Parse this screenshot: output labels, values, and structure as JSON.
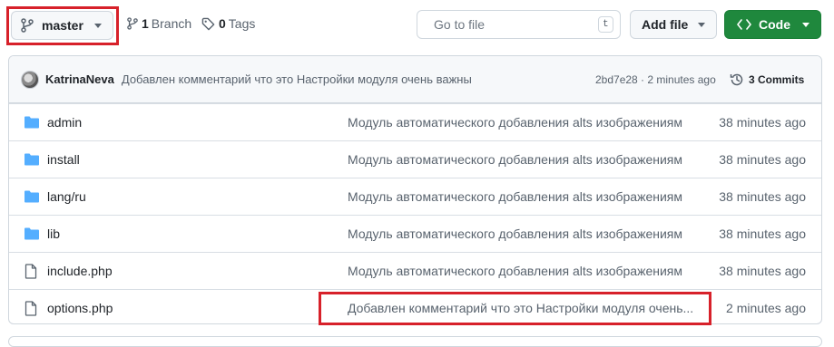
{
  "toolbar": {
    "branch_label": "master",
    "branches_count": "1",
    "branches_label": "Branch",
    "tags_count": "0",
    "tags_label": "Tags",
    "search_placeholder": "Go to file",
    "search_shortcut": "t",
    "add_file_label": "Add file",
    "code_label": "Code",
    "code_color": "#1f883d"
  },
  "latest_commit": {
    "author": "KatrinaNeva",
    "message": "Добавлен комментарий что это Настройки модуля очень важны",
    "hash_time": "2bd7e28 · 2 minutes ago",
    "commits_label": "3 Commits"
  },
  "files": [
    {
      "name": "admin",
      "type": "folder",
      "message": "Модуль автоматического добавления alts изображениям",
      "age": "38 minutes ago"
    },
    {
      "name": "install",
      "type": "folder",
      "message": "Модуль автоматического добавления alts изображениям",
      "age": "38 minutes ago"
    },
    {
      "name": "lang/ru",
      "type": "folder",
      "message": "Модуль автоматического добавления alts изображениям",
      "age": "38 minutes ago"
    },
    {
      "name": "lib",
      "type": "folder",
      "message": "Модуль автоматического добавления alts изображениям",
      "age": "38 minutes ago"
    },
    {
      "name": "include.php",
      "type": "file",
      "message": "Модуль автоматического добавления alts изображениям",
      "age": "38 minutes ago"
    },
    {
      "name": "options.php",
      "type": "file",
      "message": "Добавлен комментарий что это Настройки модуля очень...",
      "age": "2 minutes ago"
    }
  ],
  "highlight_color": "#d7212a"
}
